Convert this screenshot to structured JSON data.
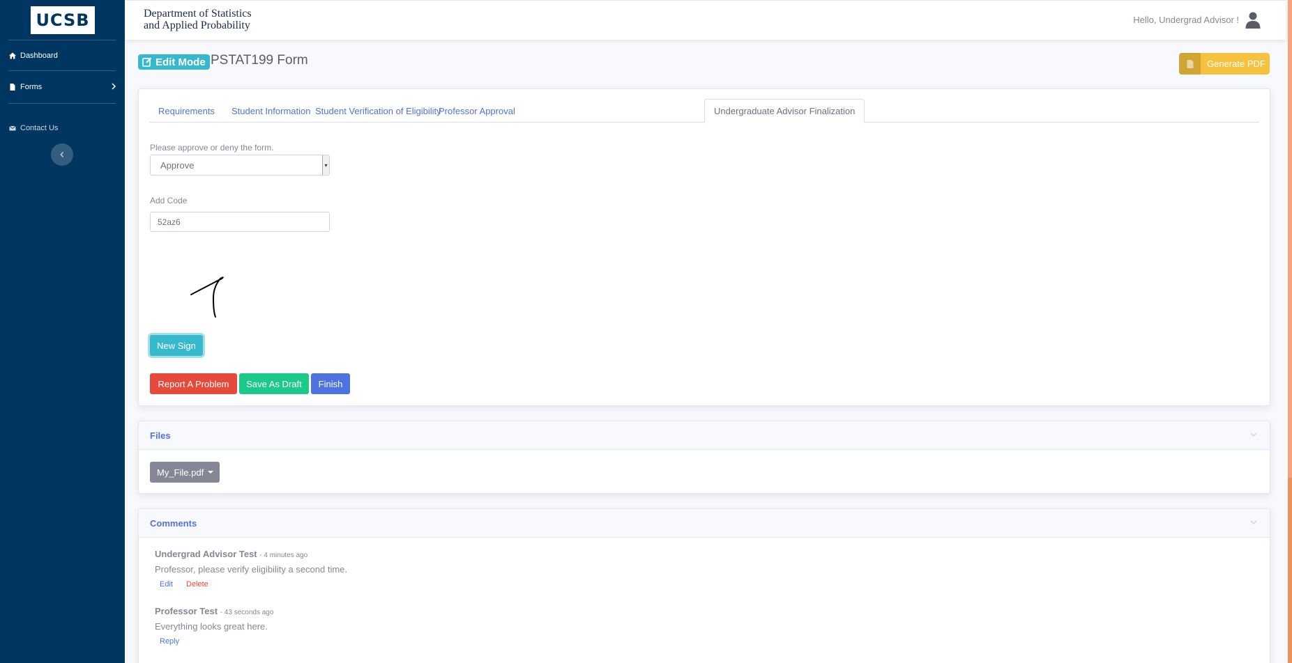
{
  "sidebar": {
    "logo": "UCSB",
    "items": [
      {
        "label": "Dashboard",
        "icon": "home-icon"
      },
      {
        "label": "Forms",
        "icon": "file-icon"
      },
      {
        "label": "Contact Us",
        "icon": "envelope-icon"
      }
    ]
  },
  "topbar": {
    "dept_line1": "Department of Statistics",
    "dept_line2": "and Applied Probability",
    "greeting": "Hello, Undergrad Advisor !"
  },
  "header": {
    "mode_badge": "Edit Mode",
    "title": "PSTAT199 Form",
    "generate_pdf": "Generate PDF"
  },
  "tabs": [
    {
      "label": "Requirements",
      "active": false
    },
    {
      "label": "Student Information",
      "active": false
    },
    {
      "label": "Student Verification of Eligibility",
      "active": false
    },
    {
      "label": "Professor Approval",
      "active": false
    },
    {
      "label": "Undergraduate Advisor Finalization",
      "active": true
    }
  ],
  "form": {
    "approve_label": "Please approve or deny the form.",
    "approve_value": "Approve",
    "code_label": "Add Code",
    "code_value": "52az6",
    "new_sign": "New Sign",
    "report": "Report A Problem",
    "save_draft": "Save As Draft",
    "finish": "Finish"
  },
  "files": {
    "title": "Files",
    "file_name": "My_File.pdf"
  },
  "comments": {
    "title": "Comments",
    "items": [
      {
        "author": "Undergrad Advisor Test",
        "time": "- 4 minutes ago",
        "body": "Professor, please verify eligibility a second time.",
        "actions": [
          "Edit",
          "Delete"
        ]
      },
      {
        "author": "Professor Test",
        "time": "- 43 seconds ago",
        "body": "Everything looks great here.",
        "actions": [
          "Reply"
        ]
      }
    ]
  },
  "colors": {
    "sidebar": "#003660",
    "info": "#36b9cc",
    "warning": "#f6c23e",
    "danger": "#e74a3b",
    "success": "#1cc88a",
    "primary": "#4e73df",
    "secondary": "#858796"
  }
}
